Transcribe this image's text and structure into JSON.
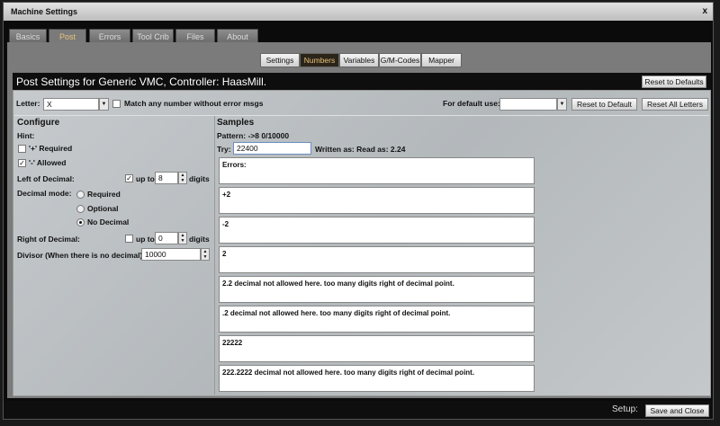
{
  "window": {
    "title": "Machine Settings",
    "close": "x"
  },
  "tabs": [
    "Basics",
    "Post",
    "Errors",
    "Tool Crib",
    "Files",
    "About"
  ],
  "active_tab": "Post",
  "subtabs": [
    "Settings",
    "Numbers",
    "Variables",
    "G/M-Codes",
    "Mapper"
  ],
  "active_subtab": "Numbers",
  "header": {
    "title": "Post Settings for Generic VMC, Controller: HaasMill.",
    "reset_defaults": "Reset to Defaults"
  },
  "letter_row": {
    "label": "Letter:",
    "value": "X",
    "match_label": "Match any number without error msgs",
    "match_checked": false,
    "default_use_label": "For default use:",
    "default_use_value": "",
    "reset_default": "Reset to Default",
    "reset_all": "Reset All Letters"
  },
  "configure": {
    "title": "Configure",
    "hint": "Hint:",
    "plus_required": {
      "label": "'+' Required",
      "checked": false
    },
    "minus_allowed": {
      "label": "'-' Allowed",
      "checked": true
    },
    "left_label": "Left of Decimal:",
    "left_upto": {
      "label": "up to",
      "checked": true,
      "value": "8",
      "unit": "digits"
    },
    "decimal_mode_label": "Decimal mode:",
    "decimal_modes": [
      "Required",
      "Optional",
      "No Decimal"
    ],
    "decimal_mode_selected": "No Decimal",
    "right_label": "Right of Decimal:",
    "right_upto": {
      "label": "up to",
      "checked": false,
      "value": "0",
      "unit": "digits"
    },
    "divisor_label": "Divisor (When there is no decimal):",
    "divisor_value": "10000"
  },
  "samples": {
    "title": "Samples",
    "pattern": "Pattern:  ->8 0/10000",
    "try_label": "Try:",
    "try_value": "22400",
    "written_as": "Written as:  Read as: 2.24",
    "boxes": [
      "Errors:",
      "+2",
      "-2",
      "2",
      "2.2  decimal not allowed here.  too many digits right of decimal point.",
      ".2  decimal not allowed here.  too many digits right of decimal point.",
      "22222",
      "222.2222  decimal not allowed here.  too many digits right of decimal point."
    ]
  },
  "footer": {
    "setup_label": "Setup:",
    "save_close": "Save and Close"
  }
}
